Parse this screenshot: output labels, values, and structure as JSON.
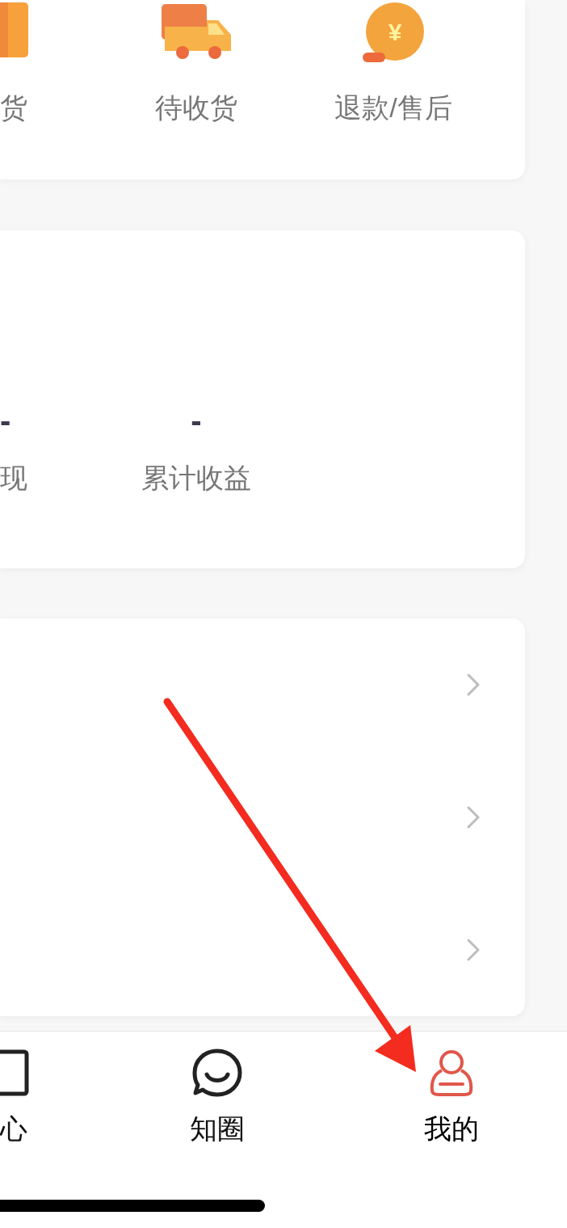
{
  "orders": {
    "items": [
      {
        "label": "货",
        "kind": "box"
      },
      {
        "label": "待收货",
        "kind": "truck"
      },
      {
        "label": "退款/售后",
        "kind": "coin",
        "icon_text": "¥"
      }
    ]
  },
  "earnings": {
    "items": [
      {
        "value": "-",
        "label": "现"
      },
      {
        "value": "-",
        "label": "累计收益"
      }
    ]
  },
  "menu": {
    "rows": [
      {
        "kind": "link"
      },
      {
        "kind": "link"
      },
      {
        "kind": "link"
      }
    ]
  },
  "tab_bar": {
    "items": [
      {
        "label": "心",
        "kind": "square",
        "selected": false
      },
      {
        "label": "知圈",
        "kind": "chat",
        "selected": false
      },
      {
        "label": "我的",
        "kind": "person",
        "selected": true
      }
    ]
  },
  "annotation": {
    "kind": "arrow"
  }
}
